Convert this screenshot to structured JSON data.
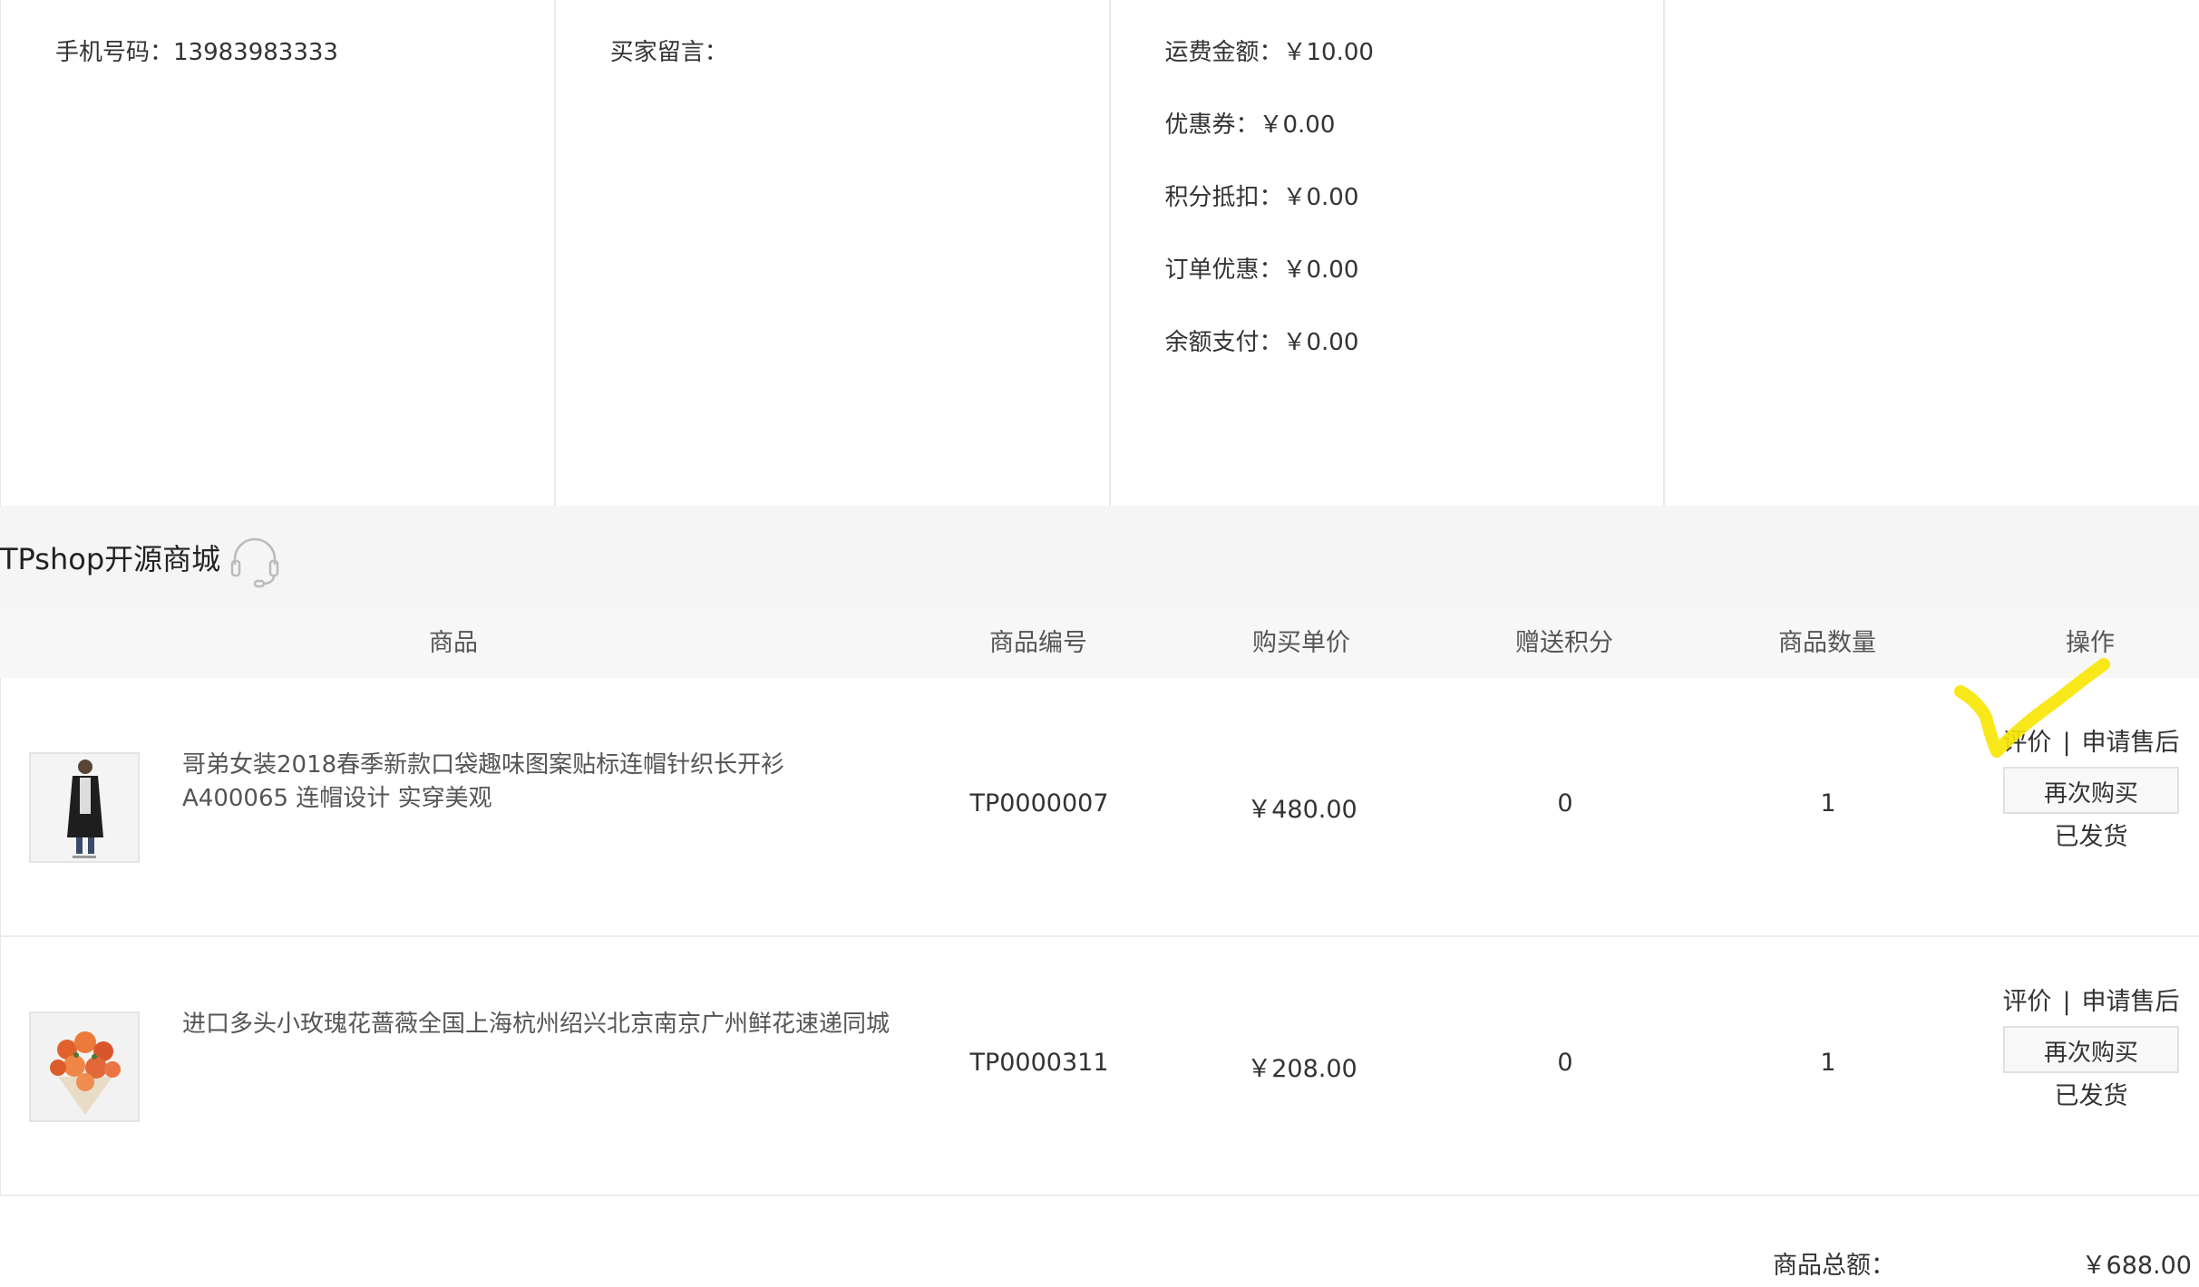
{
  "order_info": {
    "phone": "手机号码：13983983333",
    "buyer_note": "买家留言：",
    "fees": [
      "运费金额：￥10.00",
      "优惠券：￥0.00",
      "积分抵扣：￥0.00",
      "订单优惠：￥0.00",
      "余额支付：￥0.00"
    ]
  },
  "shop": {
    "name": "TPshop开源商城",
    "service_icon": "headset-icon"
  },
  "table": {
    "headers": {
      "product": "商品",
      "sku": "商品编号",
      "unit_price": "购买单价",
      "points": "赠送积分",
      "quantity": "商品数量",
      "actions": "操作"
    },
    "rows": [
      {
        "name": "哥弟女装2018春季新款口袋趣味图案贴标连帽针织长开衫A400065 连帽设计 实穿美观",
        "sku": "TP0000007",
        "price": "￥480.00",
        "points": "0",
        "qty": "1",
        "review": "评价",
        "separator": "|",
        "after_sale": "申请售后",
        "rebuy": "再次购买",
        "status": "已发货"
      },
      {
        "name": "进口多头小玫瑰花蔷薇全国上海杭州绍兴北京南京广州鲜花速递同城",
        "sku": "TP0000311",
        "price": "￥208.00",
        "points": "0",
        "qty": "1",
        "review": "评价",
        "separator": "|",
        "after_sale": "申请售后",
        "rebuy": "再次购买",
        "status": "已发货"
      }
    ]
  },
  "summary": {
    "total_label": "商品总额：",
    "total_value": "￥688.00"
  },
  "colors": {
    "annotation": "#f7e600",
    "header_bg": "#f7f7f7",
    "shop_bar_bg": "#f5f5f5"
  }
}
